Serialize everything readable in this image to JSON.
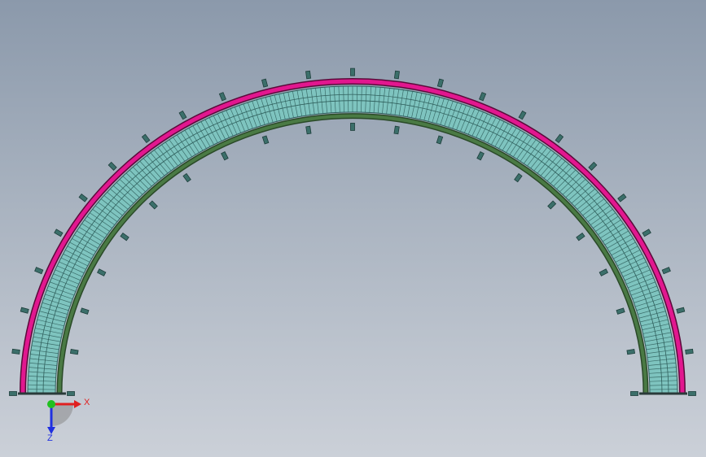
{
  "viewport": {
    "background_top": "#8b99ab",
    "background_bottom": "#cbd0d8"
  },
  "model": {
    "shape": "semicircular-curved-belt-conveyor",
    "outer_rail_color": "#e2178f",
    "inner_rail_color": "#4a7a44",
    "belt_color": "#7ec4bf",
    "belt_line_color": "#2f5f5c",
    "bracket_color": "#3b6f6a",
    "outer_support_count": 25,
    "inner_support_count": 21
  },
  "triad": {
    "x_label": "X",
    "z_label": "Z",
    "x_color": "#e02020",
    "y_color": "#20c020",
    "z_color": "#2030e0"
  }
}
